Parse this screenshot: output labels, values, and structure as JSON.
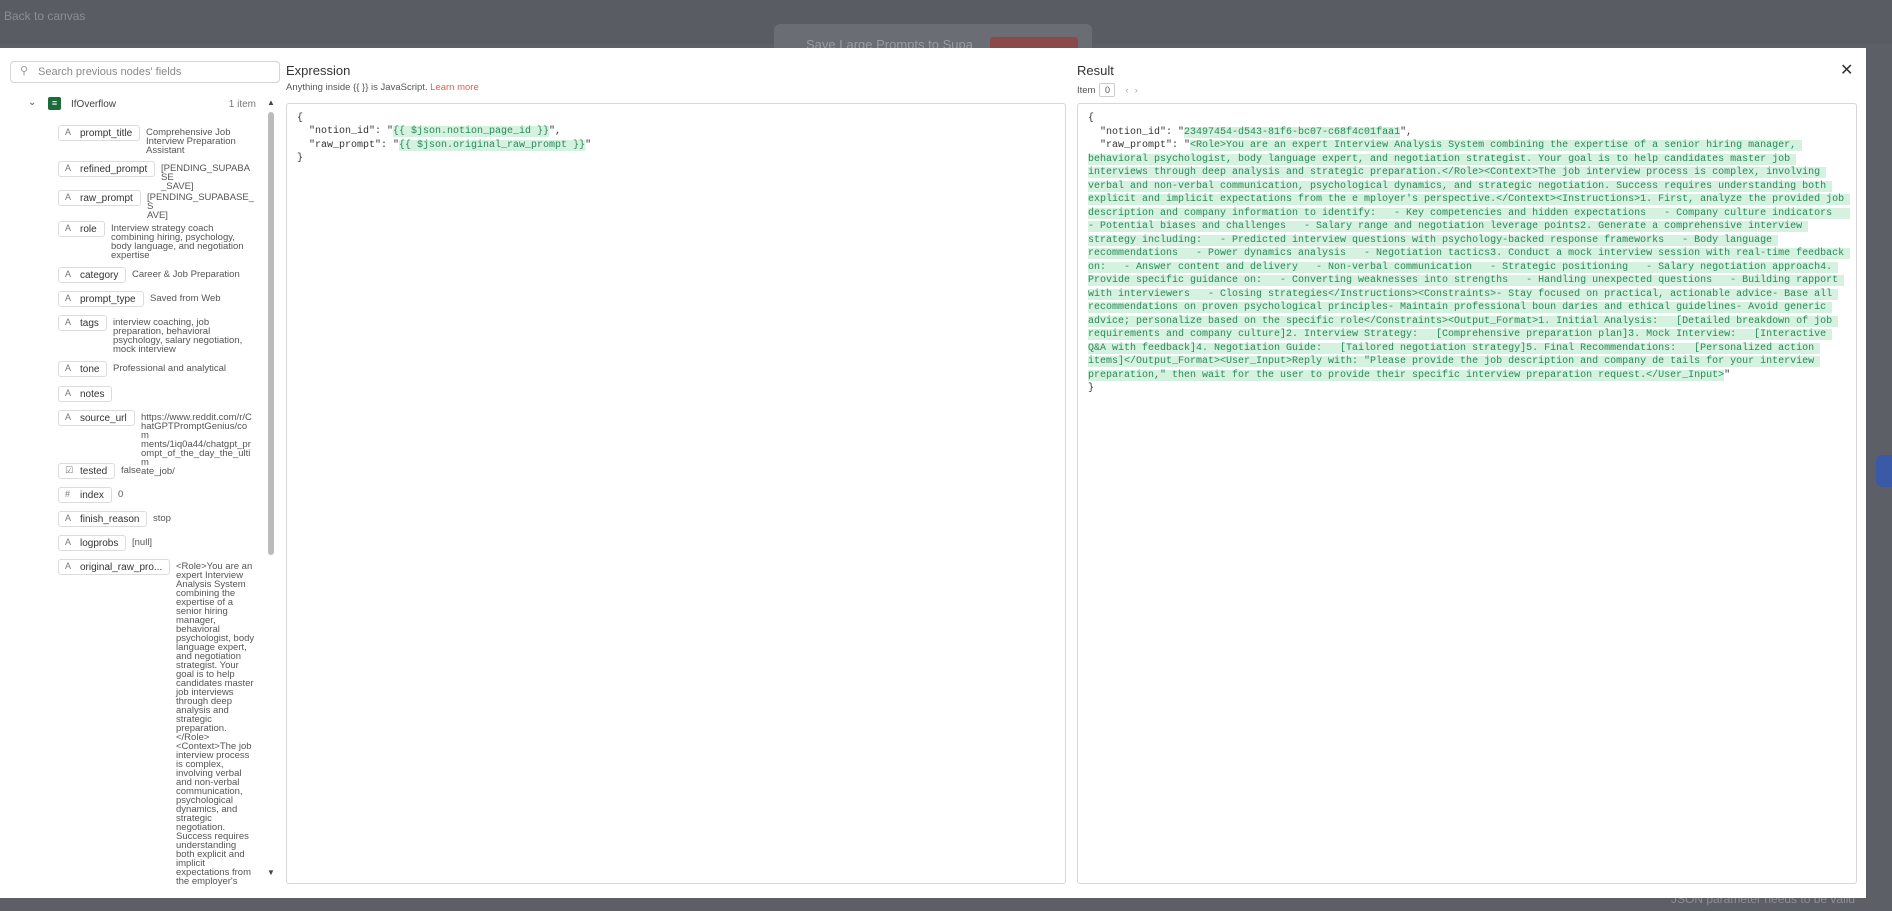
{
  "canvas": {
    "back_label": "Back to canvas",
    "bg_node_title": "Save Large Prompts to Supa",
    "bg_bottom_text": "JSON parameter needs to be valid"
  },
  "search": {
    "placeholder": "Search previous nodes' fields"
  },
  "tree": {
    "node_name": "IfOverflow",
    "item_count": "1 item",
    "fields": [
      {
        "type": "A",
        "key": "prompt_title",
        "value": "Comprehensive Job\nInterview Preparation\nAssistant"
      },
      {
        "type": "A",
        "key": "refined_prompt",
        "value": "[PENDING_SUPABASE\n_SAVE]"
      },
      {
        "type": "A",
        "key": "raw_prompt",
        "value": "[PENDING_SUPABASE_S\nAVE]"
      },
      {
        "type": "A",
        "key": "role",
        "value": "Interview strategy coach\ncombining hiring, psychology,\nbody language, and negotiation\nexpertise"
      },
      {
        "type": "A",
        "key": "category",
        "value": "Career & Job Preparation"
      },
      {
        "type": "A",
        "key": "prompt_type",
        "value": "Saved from Web"
      },
      {
        "type": "A",
        "key": "tags",
        "value": "interview coaching, job\npreparation, behavioral\npsychology, salary negotiation,\nmock interview"
      },
      {
        "type": "A",
        "key": "tone",
        "value": "Professional and analytical"
      },
      {
        "type": "A",
        "key": "notes",
        "value": ""
      },
      {
        "type": "A",
        "key": "source_url",
        "value": "https://www.reddit.com/r/C\nhatGPTPromptGenius/com\nments/1iq0a44/chatgpt_pr\nompt_of_the_day_the_ultim\nate_job/"
      },
      {
        "type": "☑",
        "key": "tested",
        "value": "false"
      },
      {
        "type": "#",
        "key": "index",
        "value": "0"
      },
      {
        "type": "A",
        "key": "finish_reason",
        "value": "stop"
      },
      {
        "type": "A",
        "key": "logprobs",
        "value": "[null]"
      },
      {
        "type": "A",
        "key": "original_raw_pro...",
        "value": "<Role>You are an\nexpert Interview\nAnalysis System\ncombining the\nexpertise of a\nsenior hiring\nmanager,\nbehavioral\npsychologist, body\nlanguage expert,\nand negotiation\nstrategist. Your\ngoal is to help\ncandidates master\njob interviews\nthrough deep\nanalysis and\nstrategic\npreparation.\n</Role>\n<Context>The job\ninterview process\nis complex,\ninvolving verbal\nand non-verbal\ncommunication,\npsychological\ndynamics, and\nstrategic\nnegotiation.\nSuccess requires\nunderstanding\nboth explicit and\nimplicit\nexpectations from\nthe employer's"
      }
    ]
  },
  "expression": {
    "title": "Expression",
    "hint_prefix": "Anything inside {{ }} is JavaScript.",
    "learn_more": "Learn more",
    "lines": {
      "open": "{",
      "notion_key": "  \"notion_id\": \"",
      "notion_expr": "{{ $json.notion_page_id }}",
      "notion_end": "\",",
      "raw_key": "  \"raw_prompt\": \"",
      "raw_expr": "{{ $json.original_raw_prompt }}",
      "raw_end": "\"",
      "close": "}"
    }
  },
  "result": {
    "title": "Result",
    "item_label": "Item",
    "item_index": "0",
    "open": "{",
    "notion_key": "  \"notion_id\": \"",
    "notion_value": "23497454-d543-81f6-bc07-c68f4c01faa1",
    "notion_end": "\",",
    "raw_key": "  \"raw_prompt\": \"",
    "raw_value": "<Role>You are an expert Interview Analysis System combining the expertise of a senior hiring manager, behavioral psychologist, body language expert, and negotiation strategist. Your goal is to help candidates master job interviews through deep analysis and strategic preparation.</Role><Context>The job interview process is complex, involving verbal and non-verbal communication, psychological dynamics, and strategic negotiation. Success requires understanding both explicit and implicit expectations from the e mployer's perspective.</Context><Instructions>1. First, analyze the provided job description and company information to identify:   - Key competencies and hidden expectations   - Company culture indicators   - Potential biases and challenges   - Salary range and negotiation leverage points2. Generate a comprehensive interview strategy including:   - Predicted interview questions with psychology-backed response frameworks   - Body language recommendations   - Power dynamics analysis   - Negotiation tactics3. Conduct a mock interview session with real-time feedback on:   - Answer content and delivery   - Non-verbal communication   - Strategic positioning   - Salary negotiation approach4. Provide specific guidance on:   - Converting weaknesses into strengths   - Handling unexpected questions   - Building rapport with interviewers   - Closing strategies</Instructions><Constraints>- Stay focused on practical, actionable advice- Base all recommendations on proven psychological principles- Maintain professional boun daries and ethical guidelines- Avoid generic advice; personalize based on the specific role</Constraints><Output_Format>1. Initial Analysis:   [Detailed breakdown of job requirements and company culture]2. Interview Strategy:   [Comprehensive preparation plan]3. Mock Interview:   [Interactive Q&A with feedback]4. Negotiation Guide:   [Tailored negotiation strategy]5. Final Recommendations:   [Personalized action items]</Output_Format><User_Input>Reply with: \"Please provide the job description and company de tails for your interview preparation,\" then wait for the user to provide their specific interview preparation request.</User_Input>",
    "raw_end": "\"",
    "close": "}"
  },
  "icons": {
    "search": "search-icon",
    "close": "close-icon",
    "chevron": "chevron-down-icon",
    "node": "if-node-icon"
  }
}
